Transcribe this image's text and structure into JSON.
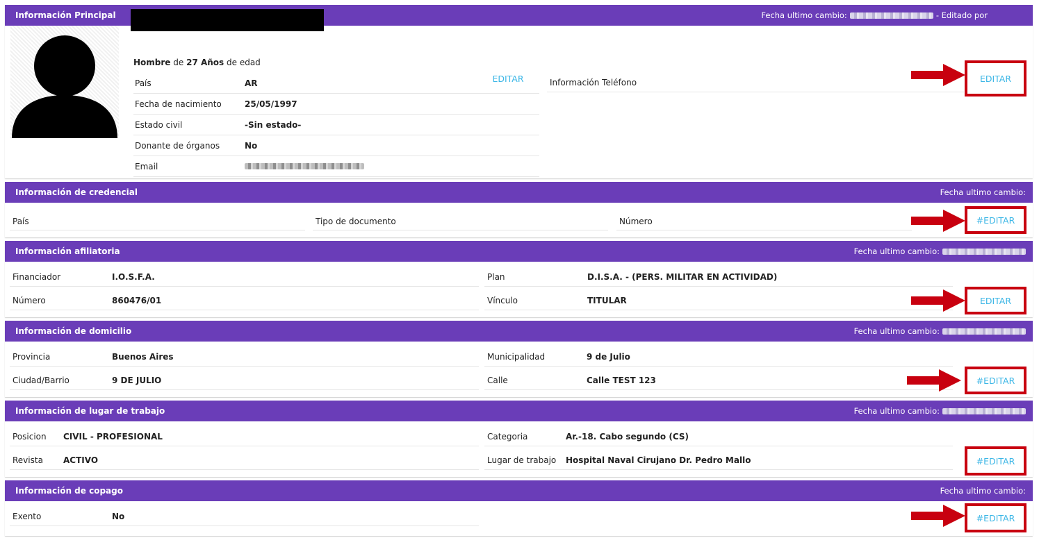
{
  "colors": {
    "header": "#6a3db8",
    "edit": "#3bb6e6",
    "highlight": "#c8000f"
  },
  "principal": {
    "title": "Información Principal",
    "date_label": "Fecha ultimo cambio:",
    "edited_by": "- Editado por",
    "sex": "Hombre",
    "de": "de",
    "age": "27 Años",
    "age_suffix": "de edad",
    "fields": [
      {
        "label": "País",
        "value": "AR"
      },
      {
        "label": "Fecha de nacimiento",
        "value": "25/05/1997"
      },
      {
        "label": "Estado civil",
        "value": "-Sin estado-"
      },
      {
        "label": "Donante de órganos",
        "value": "No"
      },
      {
        "label": "Email",
        "value": ""
      }
    ],
    "edit_left": "EDITAR",
    "phone_label": "Información Teléfono",
    "edit_right": "EDITAR"
  },
  "credencial": {
    "title": "Información de credencial",
    "date_label": "Fecha ultimo cambio:",
    "fields": [
      {
        "label": "País"
      },
      {
        "label": "Tipo de documento"
      },
      {
        "label": "Número"
      }
    ],
    "edit": "#EDITAR"
  },
  "afiliatoria": {
    "title": "Información afiliatoria",
    "date_label": "Fecha ultimo cambio:",
    "fields": [
      {
        "label": "Financiador",
        "value": "I.O.S.F.A."
      },
      {
        "label": "Plan",
        "value": "D.I.S.A. - (PERS. MILITAR EN ACTIVIDAD)"
      },
      {
        "label": "Número",
        "value": "860476/01"
      },
      {
        "label": "Vínculo",
        "value": "TITULAR"
      }
    ],
    "edit": "EDITAR"
  },
  "domicilio": {
    "title": "Información de domicilio",
    "date_label": "Fecha ultimo cambio:",
    "fields": [
      {
        "label": "Provincia",
        "value": "Buenos Aires"
      },
      {
        "label": "Municipalidad",
        "value": "9 de Julio"
      },
      {
        "label": "Ciudad/Barrio",
        "value": "9 DE JULIO"
      },
      {
        "label": "Calle",
        "value": "Calle TEST 123"
      }
    ],
    "edit": "#EDITAR"
  },
  "trabajo": {
    "title": "Información de lugar de trabajo",
    "date_label": "Fecha ultimo cambio:",
    "fields": [
      {
        "label": "Posicion",
        "value": "CIVIL - PROFESIONAL"
      },
      {
        "label": "Categoria",
        "value": "Ar.-18. Cabo segundo (CS)"
      },
      {
        "label": "Revista",
        "value": "ACTIVO"
      },
      {
        "label": "Lugar de trabajo",
        "value": "Hospital Naval Cirujano Dr. Pedro Mallo"
      }
    ],
    "edit": "#EDITAR"
  },
  "copago": {
    "title": "Información de copago",
    "date_label": "Fecha ultimo cambio:",
    "fields": [
      {
        "label": "Exento",
        "value": "No"
      }
    ],
    "edit": "#EDITAR"
  }
}
